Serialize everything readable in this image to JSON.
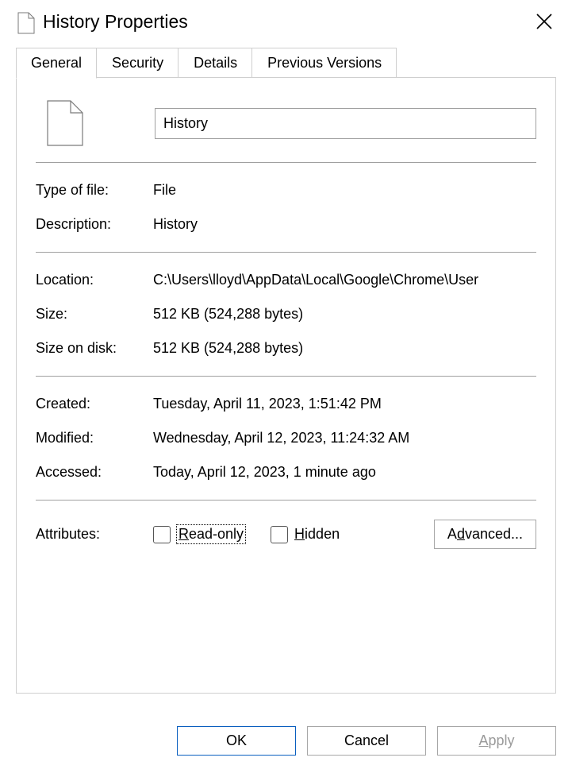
{
  "window": {
    "title": "History Properties"
  },
  "tabs": {
    "general": "General",
    "security": "Security",
    "details": "Details",
    "previous": "Previous Versions"
  },
  "file": {
    "name": "History"
  },
  "props": {
    "type_label": "Type of file:",
    "type_value": "File",
    "desc_label": "Description:",
    "desc_value": "History",
    "loc_label": "Location:",
    "loc_value": "C:\\Users\\lloyd\\AppData\\Local\\Google\\Chrome\\User",
    "size_label": "Size:",
    "size_value": "512 KB (524,288 bytes)",
    "disk_label": "Size on disk:",
    "disk_value": "512 KB (524,288 bytes)",
    "created_label": "Created:",
    "created_value": "Tuesday, April 11, 2023, 1:51:42 PM",
    "modified_label": "Modified:",
    "modified_value": "Wednesday, April 12, 2023, 11:24:32 AM",
    "accessed_label": "Accessed:",
    "accessed_value": "Today, April 12, 2023, 1 minute ago"
  },
  "attributes": {
    "label": "Attributes:",
    "readonly_prefix": "R",
    "readonly_rest": "ead-only",
    "hidden_prefix": "H",
    "hidden_rest": "idden",
    "advanced_prefix": "A",
    "advanced_ul": "d",
    "advanced_rest": "vanced..."
  },
  "buttons": {
    "ok": "OK",
    "cancel": "Cancel",
    "apply_ul": "A",
    "apply_rest": "pply"
  }
}
